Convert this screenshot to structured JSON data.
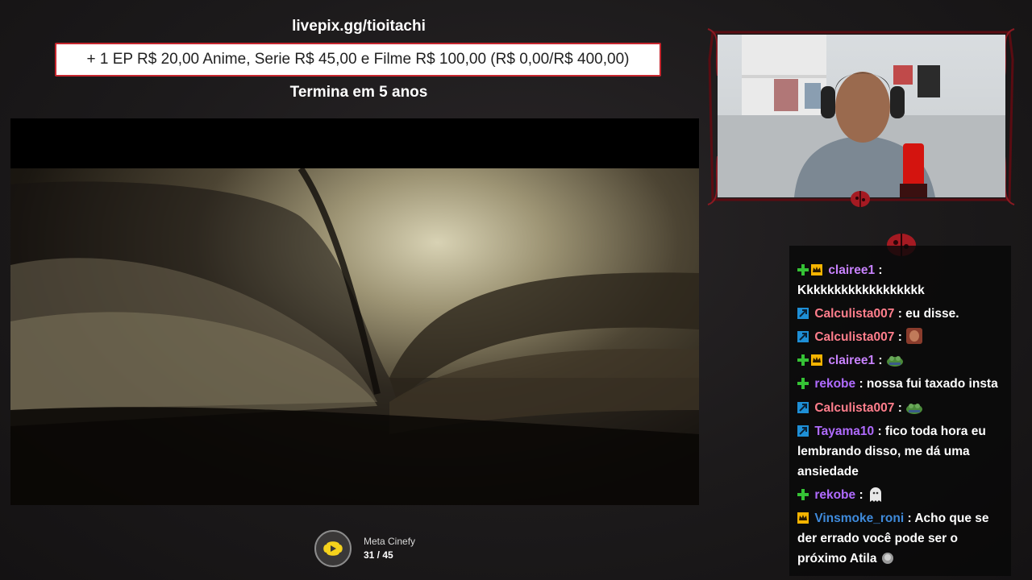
{
  "header": {
    "url": "livepix.gg/tioitachi",
    "goal_text": "+ 1 EP R$ 20,00 Anime, Serie R$ 45,00 e Filme R$ 100,00 (R$ 0,00/R$ 400,00)",
    "ends_text": "Termina em 5 anos"
  },
  "chat": {
    "messages": [
      {
        "user": "clairee1",
        "sep": " :",
        "text": "Kkkkkkkkkkkkkkkkkk",
        "user_color": "#c882ff",
        "badges": [
          "plus",
          "crown"
        ],
        "emote": null
      },
      {
        "user": "Calculista007",
        "sep": " :",
        "text": " eu disse.",
        "user_color": "#ff7e8c",
        "badges": [
          "prime"
        ],
        "emote": null
      },
      {
        "user": "Calculista007",
        "sep": " :",
        "text": "",
        "user_color": "#ff7e8c",
        "badges": [
          "prime"
        ],
        "emote": "face-emote"
      },
      {
        "user": "clairee1",
        "sep": " :",
        "text": "",
        "user_color": "#c882ff",
        "badges": [
          "plus",
          "crown"
        ],
        "emote": "frog-emote"
      },
      {
        "user": "rekobe",
        "sep": " :",
        "text": " nossa fui taxado insta",
        "user_color": "#b06bff",
        "badges": [
          "plus"
        ],
        "emote": null
      },
      {
        "user": "Calculista007",
        "sep": " :",
        "text": "",
        "user_color": "#ff7e8c",
        "badges": [
          "prime"
        ],
        "emote": "frog-emote"
      },
      {
        "user": "Tayama10",
        "sep": " :",
        "text": " fico toda hora eu lembrando disso, me dá uma ansiedade",
        "user_color": "#b06bff",
        "badges": [
          "prime"
        ],
        "emote": null
      },
      {
        "user": "rekobe",
        "sep": " :",
        "text": "",
        "user_color": "#b06bff",
        "badges": [
          "plus"
        ],
        "emote": "ghost-emote"
      },
      {
        "user": "Vinsmoke_roni",
        "sep": " :",
        "text": " Acho que se der errado você pode ser o próximo Atila",
        "user_color": "#3f8bdc",
        "badges": [
          "crown"
        ],
        "emote": "head-emote"
      }
    ]
  },
  "counter": {
    "label": "Meta Cinefy",
    "value": "31 / 45",
    "icon": "cinefy-logo-icon"
  },
  "colors": {
    "accent": "#c6272f",
    "chat_bg": "#080808"
  }
}
